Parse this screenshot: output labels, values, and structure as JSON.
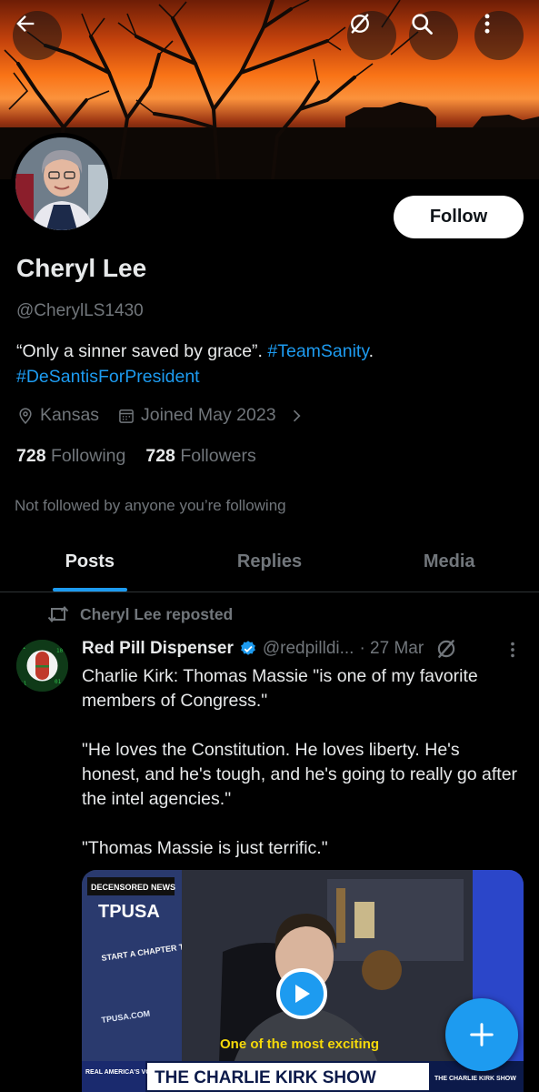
{
  "profile": {
    "name": "Cheryl Lee",
    "handle": "@CherylLS1430",
    "bio_text": "“Only a sinner saved by grace”. ",
    "bio_tag1": "#TeamSanity",
    "bio_sep": ".",
    "bio_tag2": "#DeSantisForPresident",
    "location": "Kansas",
    "joined": "Joined May 2023",
    "following_count": "728",
    "following_label": "Following",
    "followers_count": "728",
    "followers_label": "Followers",
    "not_followed": "Not followed by anyone you’re following",
    "follow_label": "Follow"
  },
  "tabs": [
    "Posts",
    "Replies",
    "Media"
  ],
  "post": {
    "repost_label": "Cheryl Lee reposted",
    "author": "Red Pill Dispenser",
    "handle": "@redpilldi...",
    "date": "· 27 Mar",
    "text": "Charlie Kirk: Thomas Massie \"is one of my favorite members of Congress.\"\n\n\"He loves the Constitution. He loves liberty. He's honest, and he's tough, and he's going to really go after the intel agencies.\"\n\n\"Thomas Massie is just terrific.\"",
    "video": {
      "logo": "DECENSORED NEWS",
      "brand": "TPUSA",
      "sign": "START A CHAPTER TODAY!",
      "url": "TPUSA.COM",
      "caption": "One of the most exciting",
      "show": "THE CHARLIE KIRK SHOW",
      "show_small": "THE CHARLIE KIRK SHOW",
      "left_logo": "REAL AMERICA'S VOICE"
    }
  },
  "colors": {
    "accent": "#1d9bf0",
    "muted": "#71767b",
    "text": "#e7e9ea",
    "background": "#000000"
  },
  "icons": [
    "back-arrow-icon",
    "grok-icon",
    "search-icon",
    "more-vertical-icon",
    "location-icon",
    "calendar-icon",
    "chevron-right-icon",
    "repost-icon",
    "verified-icon",
    "play-icon",
    "plus-icon"
  ]
}
